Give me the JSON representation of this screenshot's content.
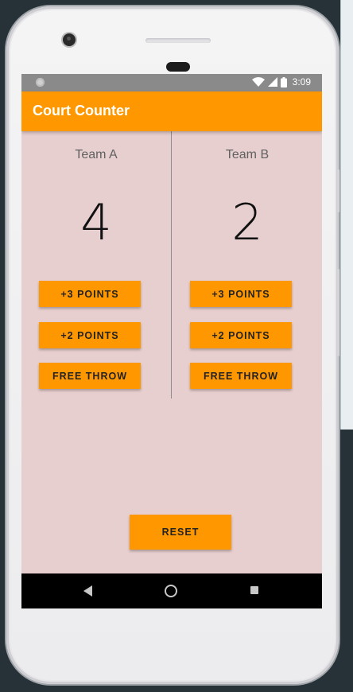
{
  "status_bar": {
    "time": "3:09",
    "icons": [
      "notification-dot-icon",
      "wifi-icon",
      "signal-icon",
      "battery-icon"
    ]
  },
  "app_bar": {
    "title": "Court Counter"
  },
  "teams": [
    {
      "name": "Team A",
      "score": "4",
      "buttons": {
        "three": "+3 POINTS",
        "two": "+2 POINTS",
        "free_throw": "FREE THROW"
      }
    },
    {
      "name": "Team B",
      "score": "2",
      "buttons": {
        "three": "+3 POINTS",
        "two": "+2 POINTS",
        "free_throw": "FREE THROW"
      }
    }
  ],
  "reset_label": "RESET",
  "nav_bar": {
    "icons": [
      "back-icon",
      "home-icon",
      "recents-icon"
    ]
  },
  "colors": {
    "accent": "#ff9800",
    "content_background": "#e8cfcf",
    "status_bar": "#8a8a8a"
  }
}
